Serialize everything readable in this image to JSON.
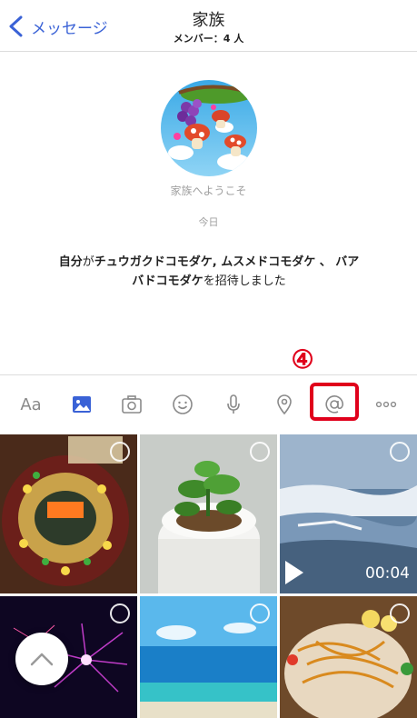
{
  "header": {
    "back_label": "メッセージ",
    "title": "家族",
    "subtitle": "メンバー：4 人"
  },
  "chat": {
    "welcome": "家族へようこそ",
    "date": "今日",
    "invite": {
      "inviter": "自分",
      "particle": "が",
      "invitees": "チュウガクドコモダケ, ムスメドコモダケ 、 バアバドコモダケ",
      "action": "を招待しました"
    }
  },
  "toolbar": {
    "text_label": "Aa",
    "step_marker": "④",
    "items": [
      "text",
      "image",
      "camera",
      "emoji",
      "microphone",
      "location",
      "mention",
      "more"
    ],
    "accent_color": "#3a62d6"
  },
  "photos": {
    "video_duration": "00:04",
    "items": [
      "food-platter",
      "basil-plant",
      "video-waves",
      "fireworks",
      "beach",
      "meat-plate"
    ]
  }
}
